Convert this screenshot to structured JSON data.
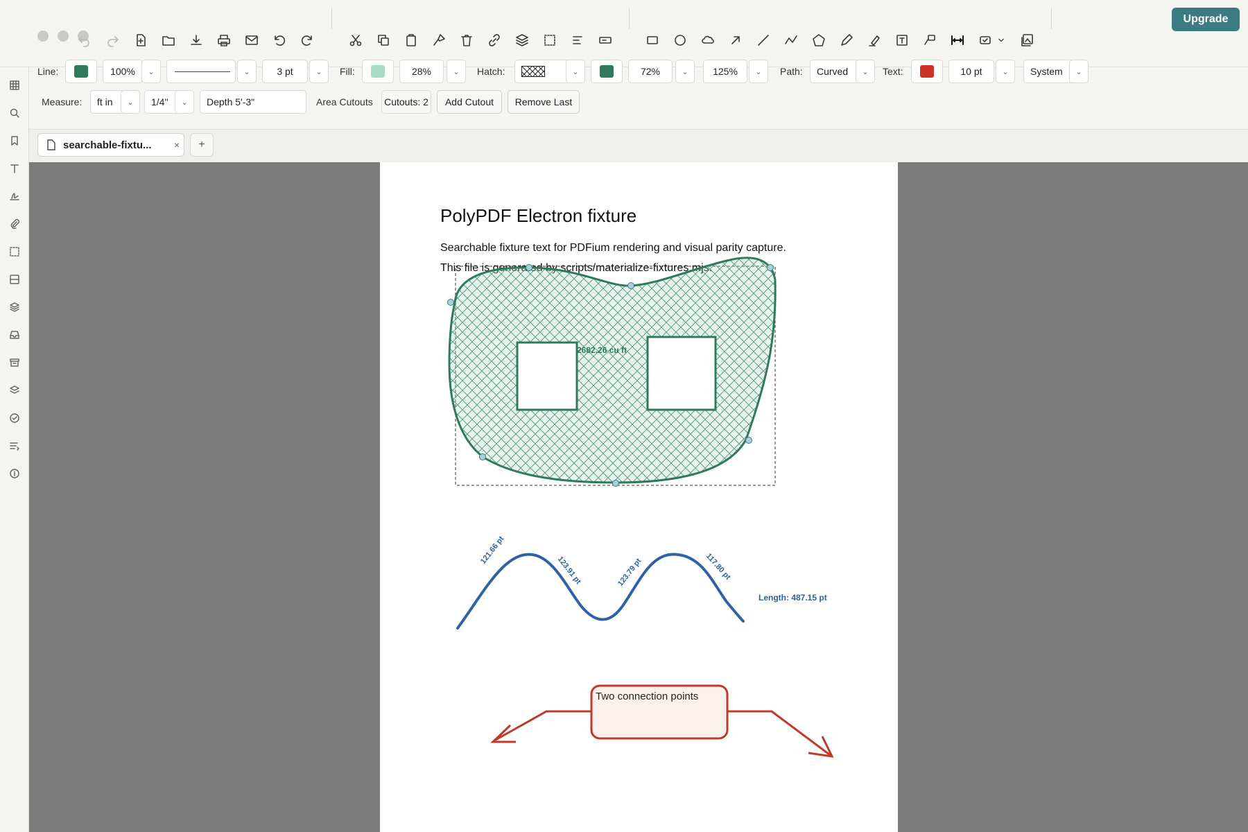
{
  "app": {
    "upgrade_label": "Upgrade"
  },
  "toolbar": {
    "icons": [
      "undo-icon",
      "redo-icon",
      "new-file-icon",
      "open-folder-icon",
      "download-icon",
      "print-icon",
      "mail-icon",
      "rotate-left-icon",
      "rotate-right-icon",
      "cut-icon",
      "copy-icon",
      "paste-icon",
      "format-paint-icon",
      "delete-icon",
      "link-icon",
      "layers-icon",
      "select-region-icon",
      "align-icon",
      "form-field-icon",
      "rectangle-icon",
      "ellipse-icon",
      "cloud-icon",
      "arrow-icon",
      "line-icon",
      "polyline-icon",
      "polygon-icon",
      "pencil-icon",
      "highlighter-icon",
      "text-box-icon",
      "callout-icon",
      "measure-icon",
      "stamp-icon",
      "chevron-down-icon",
      "image-icon"
    ]
  },
  "properties": {
    "line_label": "Line:",
    "line_color": "#2e7a5b",
    "line_opacity": "100%",
    "line_width": "3 pt",
    "fill_label": "Fill:",
    "fill_color": "#a8dcc6",
    "fill_opacity": "28%",
    "hatch_label": "Hatch:",
    "hatch_color": "#2e7a5b",
    "hatch_opacity": "72%",
    "hatch_scale": "125%",
    "path_label": "Path:",
    "path_value": "Curved",
    "text_label": "Text:",
    "text_color": "#cc3328",
    "text_size": "10 pt",
    "font_value": "System",
    "dropdown_glyph": "⌄"
  },
  "measure": {
    "label": "Measure:",
    "unit": "ft in",
    "precision": "1/4\"",
    "depth": "Depth  5'-3\"",
    "area_cutouts_label": "Area Cutouts",
    "cutouts_count": "Cutouts: 2",
    "add_cutout": "Add Cutout",
    "remove_last": "Remove Last"
  },
  "tabs": {
    "active": "searchable-fixtu...",
    "close_glyph": "×",
    "new_glyph": "+"
  },
  "rail": {
    "icons": [
      "grid-icon",
      "search-icon",
      "bookmark-icon",
      "text-icon",
      "signature-icon",
      "attachment-icon",
      "selection-icon",
      "form-icon",
      "layers-icon",
      "inbox-icon",
      "archive-icon",
      "stack-icon",
      "check-circle-icon",
      "list-icon",
      "info-icon"
    ]
  },
  "document": {
    "title": "PolyPDF Electron fixture",
    "line1": "Searchable fixture text for PDFium rendering and visual parity capture.",
    "line2": "This file is generated by scripts/materialize-fixtures.mjs."
  },
  "annotations": {
    "volume_label": "2682.26 cu ft",
    "segment_labels": [
      "121.66 pt",
      "123.91 pt",
      "123.79 pt",
      "117.80 pt"
    ],
    "length_label": "Length: 487.15 pt",
    "callout_text": "Two connection points",
    "polygon_color": "#2e7a5b",
    "measure_color": "#2d62a6",
    "callout_color": "#c0392b",
    "callout_fill": "#fdf1ee"
  }
}
